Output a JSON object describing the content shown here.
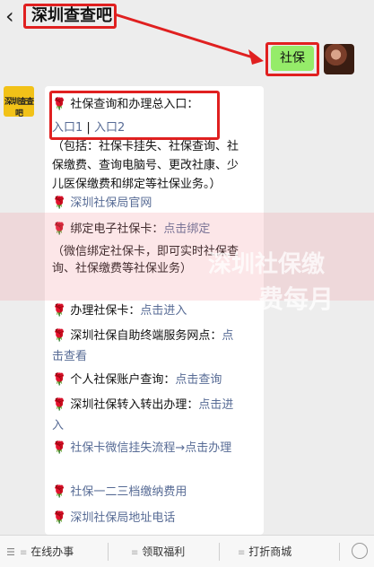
{
  "header": {
    "back_icon": "chevron-left-icon",
    "title": "深圳查查吧"
  },
  "outgoing": {
    "text": "社保"
  },
  "bot_avatar_text": "深圳查查吧",
  "message": {
    "rose_icon": "🌹",
    "l1": "社保查询和办理总入口：",
    "l2a": "入口1",
    "l2sep": "|",
    "l2b": "入口2",
    "l3": "（包括：社保卡挂失、社保查询、社",
    "l4": "保缴费、查询电脑号、更改社康、少",
    "l5": "儿医保缴费和绑定等社保业务。）",
    "l6": "深圳社保局官网",
    "l7a": "绑定电子社保卡：",
    "l7b": "点击绑定",
    "l8": "（微信绑定社保卡，即可实时社保查",
    "l9": "询、社保缴费等社保业务）",
    "l10a": "办理社保卡：",
    "l10b": "点击进入",
    "l11a": "深圳社保自助终端服务网点：",
    "l11b": "点",
    "l12": "击查看",
    "l13a": "个人社保账户查询：",
    "l13b": "点击查询",
    "l14a": "深圳社保转入转出办理：",
    "l14b": "点击进",
    "l15": "入",
    "l16": "社保卡微信挂失流程→点击办理",
    "l17": "社保一二三档缴纳费用",
    "l18": "深圳社保局地址电话"
  },
  "watermark": {
    "line1": "深圳社保缴",
    "line2": "费每月"
  },
  "bottom_bar": {
    "menu_icon": "menu-icon",
    "items": [
      "在线办事",
      "领取福利",
      "打折商城"
    ]
  }
}
